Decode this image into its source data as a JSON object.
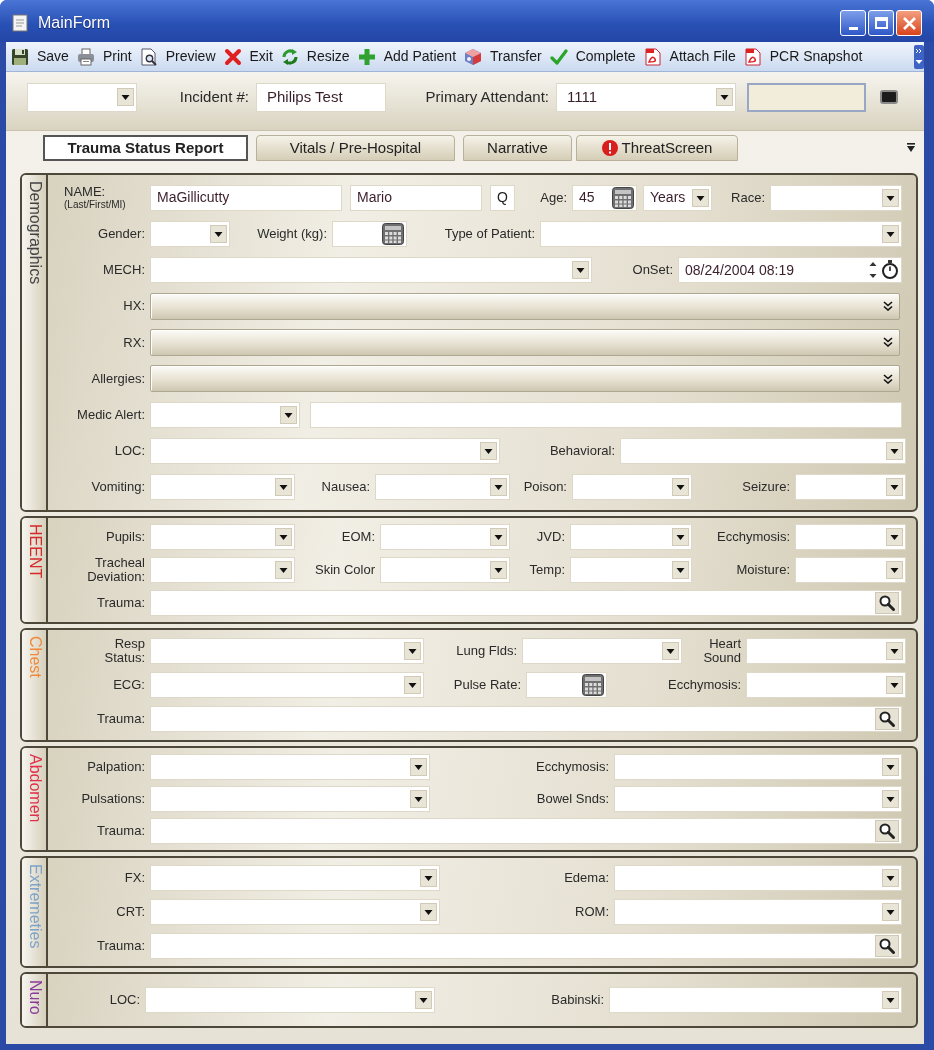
{
  "window": {
    "title": "MainForm"
  },
  "toolbar": {
    "items": [
      {
        "label": "Save"
      },
      {
        "label": "Print"
      },
      {
        "label": "Preview"
      },
      {
        "label": "Exit"
      },
      {
        "label": "Resize"
      },
      {
        "label": "Add Patient"
      },
      {
        "label": "Transfer"
      },
      {
        "label": "Complete"
      },
      {
        "label": "Attach File"
      },
      {
        "label": "PCR Snapshot"
      }
    ]
  },
  "header": {
    "fields": [
      {
        "kind": "combo"
      },
      {
        "kind": "text",
        "label": "Incident #:",
        "value": "Philips Test"
      },
      {
        "kind": "combo",
        "label": "Primary Attendant:",
        "value": "1111"
      },
      {
        "kind": "readonly"
      },
      {
        "kind": "button"
      }
    ]
  },
  "tabs": [
    {
      "label": "Trauma Status Report",
      "selected": true,
      "alert": false
    },
    {
      "label": "Vitals / Pre-Hospital",
      "selected": false,
      "alert": false
    },
    {
      "label": "Narrative",
      "selected": false,
      "alert": false
    },
    {
      "label": "ThreatScreen",
      "selected": false,
      "alert": true
    }
  ],
  "sections": [
    {
      "title": "Demographics",
      "color": "#444444",
      "lines": [
        {
          "fields": [
            {
              "kind": "text",
              "label": "NAME:",
              "sublabel": "(Last/First/MI)",
              "value": "MaGillicutty"
            },
            {
              "kind": "text",
              "value": "Mario"
            },
            {
              "kind": "button",
              "caption": "Q"
            },
            {
              "kind": "number",
              "label": "Age:",
              "value": "45"
            },
            {
              "kind": "combo",
              "value": "Years"
            },
            {
              "kind": "combo",
              "label": "Race:"
            }
          ]
        },
        {
          "fields": [
            {
              "kind": "combo",
              "label": "Gender:"
            },
            {
              "kind": "number",
              "label": "Weight (kg):"
            },
            {
              "kind": "combo",
              "label": "Type of Patient:"
            }
          ]
        },
        {
          "fields": [
            {
              "kind": "combo",
              "label": "MECH:"
            },
            {
              "kind": "datetime",
              "label": "OnSet:",
              "value": "08/24/2004 08:19"
            }
          ]
        },
        {
          "fields": [
            {
              "kind": "expander",
              "label": "HX:"
            }
          ]
        },
        {
          "fields": [
            {
              "kind": "expander",
              "label": "RX:"
            }
          ]
        },
        {
          "fields": [
            {
              "kind": "expander",
              "label": "Allergies:"
            }
          ]
        },
        {
          "fields": [
            {
              "kind": "combo",
              "label": "Medic Alert:"
            },
            {
              "kind": "text"
            }
          ]
        },
        {
          "fields": [
            {
              "kind": "combo",
              "label": "LOC:"
            },
            {
              "kind": "combo",
              "label": "Behavioral:"
            }
          ]
        },
        {
          "fields": [
            {
              "kind": "combo",
              "label": "Vomiting:"
            },
            {
              "kind": "combo",
              "label": "Nausea:"
            },
            {
              "kind": "combo",
              "label": "Poison:"
            },
            {
              "kind": "combo",
              "label": "Seizure:"
            }
          ]
        }
      ]
    },
    {
      "title": "HEENT",
      "color": "#d42a2a",
      "lines": [
        {
          "fields": [
            {
              "kind": "combo",
              "label": "Pupils:"
            },
            {
              "kind": "combo",
              "label": "EOM:"
            },
            {
              "kind": "combo",
              "label": "JVD:"
            },
            {
              "kind": "combo",
              "label": "Ecchymosis:"
            }
          ]
        },
        {
          "fields": [
            {
              "kind": "combo",
              "label": "Tracheal Deviation:"
            },
            {
              "kind": "combo",
              "label": "Skin Color"
            },
            {
              "kind": "combo",
              "label": "Temp:"
            },
            {
              "kind": "combo",
              "label": "Moisture:"
            }
          ]
        },
        {
          "fields": [
            {
              "kind": "search",
              "label": "Trauma:"
            }
          ]
        }
      ]
    },
    {
      "title": "Chest",
      "color": "#f08a3a",
      "lines": [
        {
          "fields": [
            {
              "kind": "combo",
              "label": "Resp Status:"
            },
            {
              "kind": "combo",
              "label": "Lung Flds:"
            },
            {
              "kind": "combo",
              "label": "Heart Sound"
            }
          ]
        },
        {
          "fields": [
            {
              "kind": "combo",
              "label": "ECG:"
            },
            {
              "kind": "number",
              "label": "Pulse Rate:"
            },
            {
              "kind": "combo",
              "label": "Ecchymosis:"
            }
          ]
        },
        {
          "fields": [
            {
              "kind": "search",
              "label": "Trauma:"
            }
          ]
        }
      ]
    },
    {
      "title": "Abdomen",
      "color": "#e0304a",
      "lines": [
        {
          "fields": [
            {
              "kind": "combo",
              "label": "Palpation:"
            },
            {
              "kind": "combo",
              "label": "Ecchymosis:"
            }
          ]
        },
        {
          "fields": [
            {
              "kind": "combo",
              "label": "Pulsations:"
            },
            {
              "kind": "combo",
              "label": "Bowel Snds:"
            }
          ]
        },
        {
          "fields": [
            {
              "kind": "search",
              "label": "Trauma:"
            }
          ]
        }
      ]
    },
    {
      "title": "Extremeties",
      "color": "#7fa3c8",
      "lines": [
        {
          "fields": [
            {
              "kind": "combo",
              "label": "FX:"
            },
            {
              "kind": "combo",
              "label": "Edema:"
            }
          ]
        },
        {
          "fields": [
            {
              "kind": "combo",
              "label": "CRT:"
            },
            {
              "kind": "combo",
              "label": "ROM:"
            }
          ]
        },
        {
          "fields": [
            {
              "kind": "search",
              "label": "Trauma:"
            }
          ]
        }
      ]
    },
    {
      "title": "Nuro",
      "color": "#8a3a9a",
      "lines": [
        {
          "fields": [
            {
              "kind": "combo",
              "label": "LOC:"
            },
            {
              "kind": "combo",
              "label": "Babinski:"
            }
          ]
        }
      ]
    }
  ]
}
